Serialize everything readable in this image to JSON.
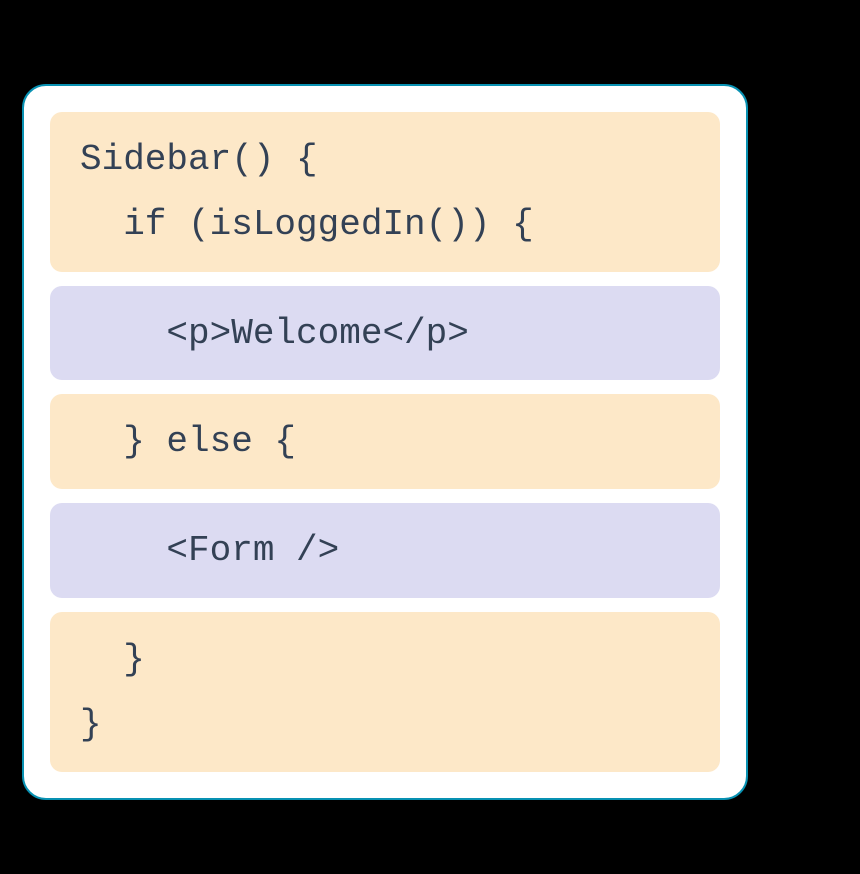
{
  "blocks": [
    {
      "style": "peach",
      "lines": [
        "Sidebar() {",
        "  if (isLoggedIn()) {"
      ]
    },
    {
      "style": "lavender",
      "lines": [
        "    <p>Welcome</p>"
      ]
    },
    {
      "style": "peach",
      "lines": [
        "  } else {"
      ]
    },
    {
      "style": "lavender",
      "lines": [
        "    <Form />"
      ]
    },
    {
      "style": "peach",
      "lines": [
        "  }",
        "}"
      ]
    }
  ]
}
